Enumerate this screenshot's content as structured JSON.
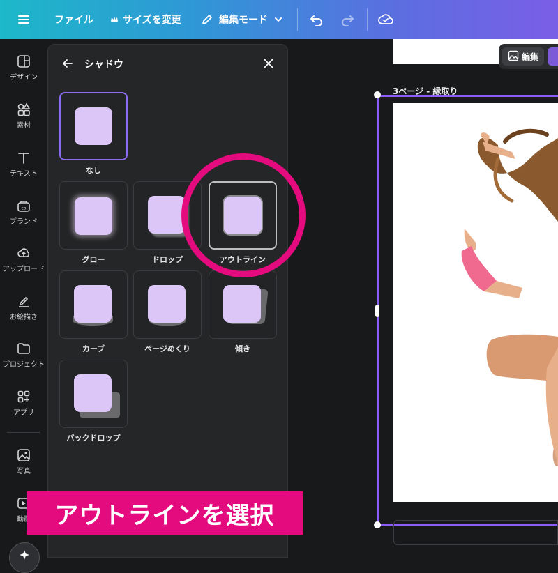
{
  "topbar": {
    "file_label": "ファイル",
    "resize_label": "サイズを変更",
    "edit_mode_label": "編集モード"
  },
  "rail": {
    "items": [
      {
        "label": "デザイン",
        "icon": "design-icon"
      },
      {
        "label": "素材",
        "icon": "elements-icon"
      },
      {
        "label": "テキスト",
        "icon": "text-icon"
      },
      {
        "label": "ブランド",
        "icon": "brand-icon"
      },
      {
        "label": "アップロード",
        "icon": "upload-icon"
      },
      {
        "label": "お絵描き",
        "icon": "draw-icon"
      },
      {
        "label": "プロジェクト",
        "icon": "folder-icon"
      },
      {
        "label": "アプリ",
        "icon": "apps-icon"
      },
      {
        "label": "写真",
        "icon": "photo-icon"
      },
      {
        "label": "動画",
        "icon": "video-icon"
      }
    ]
  },
  "panel": {
    "title": "シャドウ",
    "options": [
      {
        "label": "なし",
        "state": "selected"
      },
      {
        "label": "グロー"
      },
      {
        "label": "ドロップ"
      },
      {
        "label": "アウトライン",
        "state": "highlighted"
      },
      {
        "label": "カーブ"
      },
      {
        "label": "ページめくり"
      },
      {
        "label": "傾き"
      },
      {
        "label": "バックドロップ"
      }
    ]
  },
  "canvas": {
    "page_label": "3ページ - 縁取り",
    "edit_button_label": "編集"
  },
  "annotation": {
    "callout_text": "アウトラインを選択",
    "accent_color": "#e40b7e"
  },
  "colors": {
    "selection": "#8b5cf6",
    "swatch": "#dcc6f8"
  }
}
